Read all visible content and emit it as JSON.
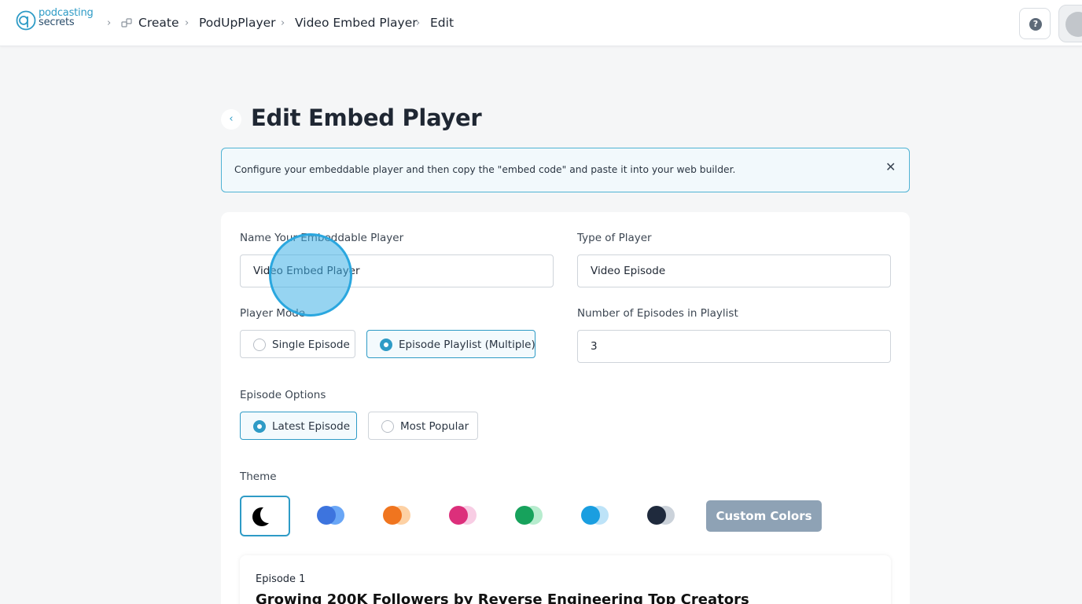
{
  "header": {
    "logo_line1": "podcasting",
    "logo_line2": "secrets",
    "breadcrumbs": [
      "Create",
      "PodUpPlayer",
      "Video Embed Player",
      "Edit"
    ],
    "help_icon": "question-circle-icon",
    "avatar_icon": "user-avatar"
  },
  "page": {
    "title": "Edit Embed Player",
    "back_icon": "chevron-left-icon"
  },
  "info_banner": {
    "text": "Configure your embeddable player and then copy the \"embed code\" and paste it into your web builder.",
    "close_icon": "close-icon"
  },
  "form": {
    "name_label": "Name Your Embeddable Player",
    "name_value": "Video Embed Player",
    "type_label": "Type of Player",
    "type_value": "Video Episode",
    "mode_label": "Player Mode",
    "mode_options": [
      "Single Episode",
      "Episode Playlist (Multiple)"
    ],
    "mode_selected": "Episode Playlist (Multiple)",
    "episodes_label": "Number of Episodes in Playlist",
    "episodes_value": "3",
    "episode_options_label": "Episode Options",
    "episode_options": [
      "Latest Episode",
      "Most Popular"
    ],
    "episode_option_selected": "Latest Episode",
    "theme_label": "Theme",
    "themes": [
      {
        "name": "dark-mode",
        "colors": [
          "#000000",
          "#ffffff"
        ],
        "selected": true
      },
      {
        "name": "blue",
        "colors": [
          "#3d74de",
          "#69a6f6"
        ],
        "selected": false
      },
      {
        "name": "orange",
        "colors": [
          "#f0751f",
          "#fdd1a4"
        ],
        "selected": false
      },
      {
        "name": "pink",
        "colors": [
          "#dc2f7b",
          "#f8cde4"
        ],
        "selected": false
      },
      {
        "name": "green",
        "colors": [
          "#17a25c",
          "#b7ecce"
        ],
        "selected": false
      },
      {
        "name": "sky",
        "colors": [
          "#1a9ee0",
          "#bde3f8"
        ],
        "selected": false
      },
      {
        "name": "slate",
        "colors": [
          "#1f2a3d",
          "#cbd2da"
        ],
        "selected": false
      }
    ],
    "custom_colors_label": "Custom Colors"
  },
  "preview": {
    "episode_number": "Episode 1",
    "episode_title": "Growing 200K Followers by Reverse Engineering Top Creators"
  },
  "colors": {
    "accent": "#2e9bc6",
    "custom_button": "#8ea2b5",
    "background": "#f5f6f7"
  }
}
